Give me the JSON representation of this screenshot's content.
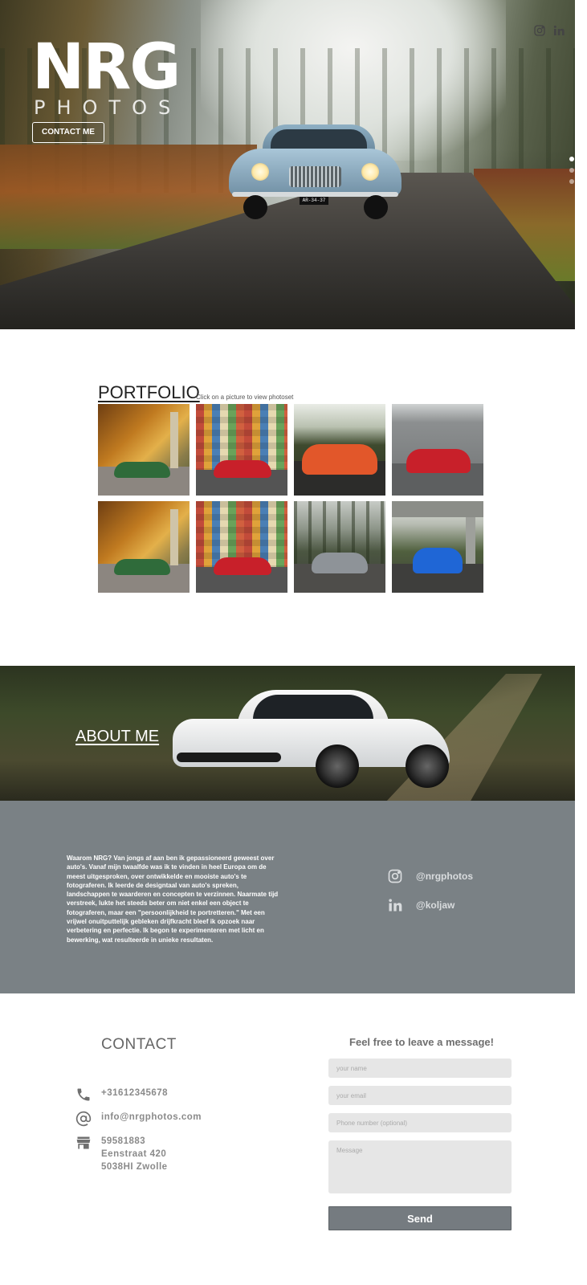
{
  "hero": {
    "logo_title": "NRG",
    "logo_subtitle": "PHOTOS",
    "contact_button": "CONTACT ME",
    "plate": "AR-34-37",
    "social_icons": [
      "instagram-icon",
      "linkedin-icon"
    ],
    "slides": 3,
    "active_slide": 1
  },
  "portfolio": {
    "title": "PORTFOLIO",
    "hint": "Click on a picture to view photoset",
    "photos": [
      {
        "name": "green-porsche",
        "car_color": "#2f6b3a"
      },
      {
        "name": "red-ferrari-colorful-wall",
        "car_color": "#c8202a"
      },
      {
        "name": "orange-aston-martin",
        "car_color": "#e2572a"
      },
      {
        "name": "red-ferrari-concrete",
        "car_color": "#c8202a"
      },
      {
        "name": "green-porsche-2",
        "car_color": "#2f6b3a"
      },
      {
        "name": "red-ferrari-colorful-wall-2",
        "car_color": "#c8202a"
      },
      {
        "name": "grey-volvo-forest",
        "car_color": "#8e9398"
      },
      {
        "name": "blue-mustang",
        "car_color": "#1f66d6"
      }
    ]
  },
  "about": {
    "title": "ABOUT ME",
    "text": "Waarom NRG? Van jongs af aan ben ik gepassioneerd geweest over auto's. Vanaf mijn twaalfde was ik te vinden in heel Europa om de meest uitgesproken, over ontwikkelde en mooiste auto's te fotograferen. Ik leerde de designtaal van auto's spreken, landschappen te waarderen en concepten te verzinnen. Naarmate tijd verstreek, lukte het steeds beter om niet enkel een object te fotograferen, maar een \"persoonlijkheid te portretteren.\" Met een vrijwel onuitputtelijk gebleken drijfkracht bleef ik opzoek naar verbetering en perfectie. Ik begon te experimenteren met licht en bewerking, wat resulteerde in unieke resultaten.",
    "instagram": "@nrgphotos",
    "linkedin": "@koljaw",
    "panel_color": "#7a8185"
  },
  "contact": {
    "title": "CONTACT",
    "phone": "+31612345678",
    "email": "info@nrgphotos.com",
    "address_line1": "59581883",
    "address_line2": "Eenstraat 420",
    "address_line3": "5038HI Zwolle"
  },
  "form": {
    "heading": "Feel free to leave a message!",
    "name_placeholder": "your name",
    "email_placeholder": "your email",
    "phone_placeholder": "Phone number (optional)",
    "message_placeholder": "Message",
    "send_label": "Send"
  }
}
